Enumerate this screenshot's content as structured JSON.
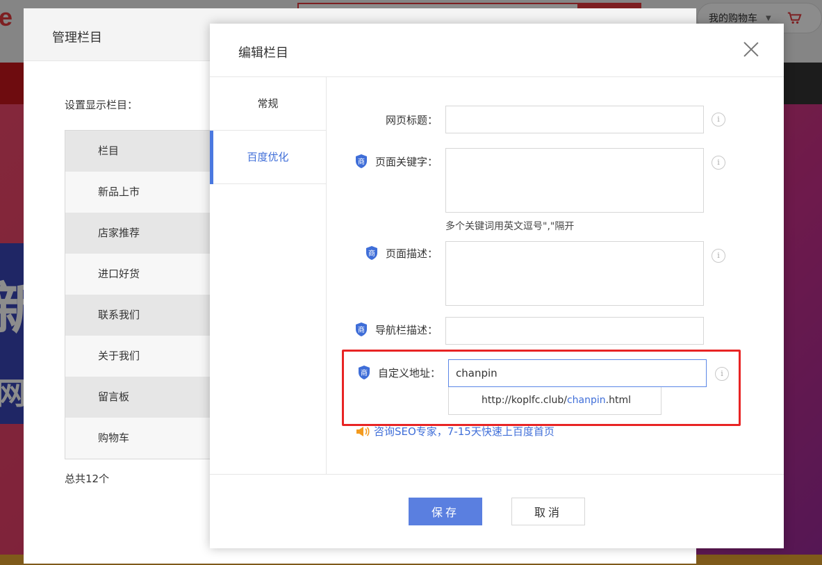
{
  "site": {
    "logo_text": "e F",
    "cart_label": "我的购物车",
    "banner_char": "新",
    "banner_char2": "网"
  },
  "outer": {
    "title": "管理栏目",
    "list_label": "设置显示栏目：",
    "columns": [
      "栏目",
      "新品上市",
      "店家推荐",
      "进口好货",
      "联系我们",
      "关于我们",
      "留言板",
      "购物车"
    ],
    "total": "总共12个"
  },
  "inner": {
    "title": "编辑栏目",
    "tabs": [
      "常规",
      "百度优化"
    ],
    "active_tab": 1,
    "fields": {
      "page_title_label": "网页标题：",
      "keywords_label": "页面关键字：",
      "keywords_hint": "多个关键词用英文逗号\",\"隔开",
      "description_label": "页面描述：",
      "nav_desc_label": "导航栏描述：",
      "custom_url_label": "自定义地址：",
      "custom_url_value": "chanpin",
      "url_prefix": "http://koplfc.club/",
      "url_slug": "chanpin",
      "url_suffix": ".html"
    },
    "info_glyph": "i",
    "seo_link": "咨询SEO专家，7-15天快速上百度首页",
    "save_label": "保存",
    "cancel_label": "取消"
  },
  "colors": {
    "accent": "#4a78e0",
    "highlight_border": "#e82424",
    "brand_red": "#e4393c"
  }
}
